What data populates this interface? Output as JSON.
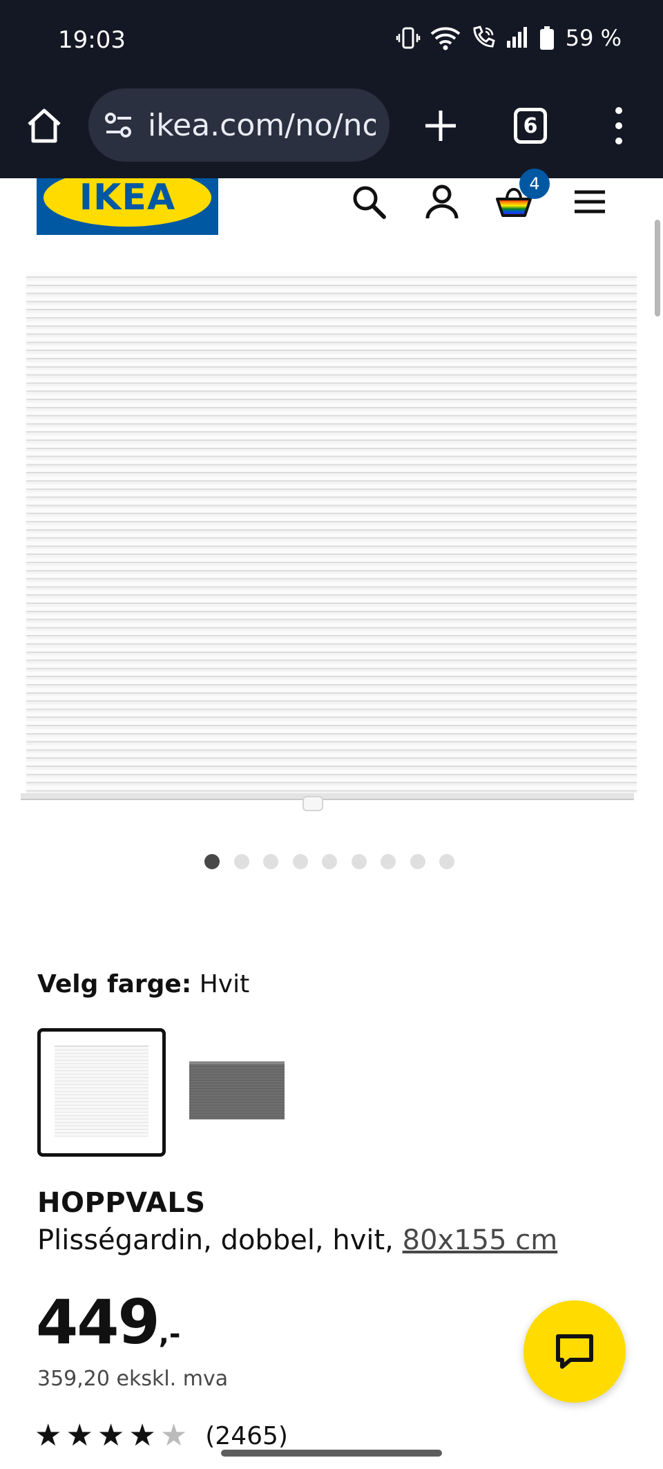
{
  "status_bar": {
    "time": "19:03",
    "battery": "59 %"
  },
  "browser": {
    "url": "ikea.com/no/no/p",
    "tab_count": "6"
  },
  "header": {
    "logo_text": "IKEA",
    "cart_count": "4"
  },
  "gallery": {
    "total_images": 9,
    "active_index": 0
  },
  "color_selector": {
    "label": "Velg farge:",
    "selected_value": "Hvit",
    "options": [
      "Hvit",
      "Grå"
    ]
  },
  "product": {
    "name": "HOPPVALS",
    "description": "Plisségardin, dobbel, hvit, ",
    "size_link": "80x155 cm",
    "price_main": "449",
    "price_suffix": ",-",
    "price_ex_vat": "359,20 ekskl. mva",
    "rating_count": "(2465)"
  },
  "colors": {
    "brand_blue": "#0058a3",
    "brand_yellow": "#ffdb00",
    "chrome_dark": "#141824"
  }
}
